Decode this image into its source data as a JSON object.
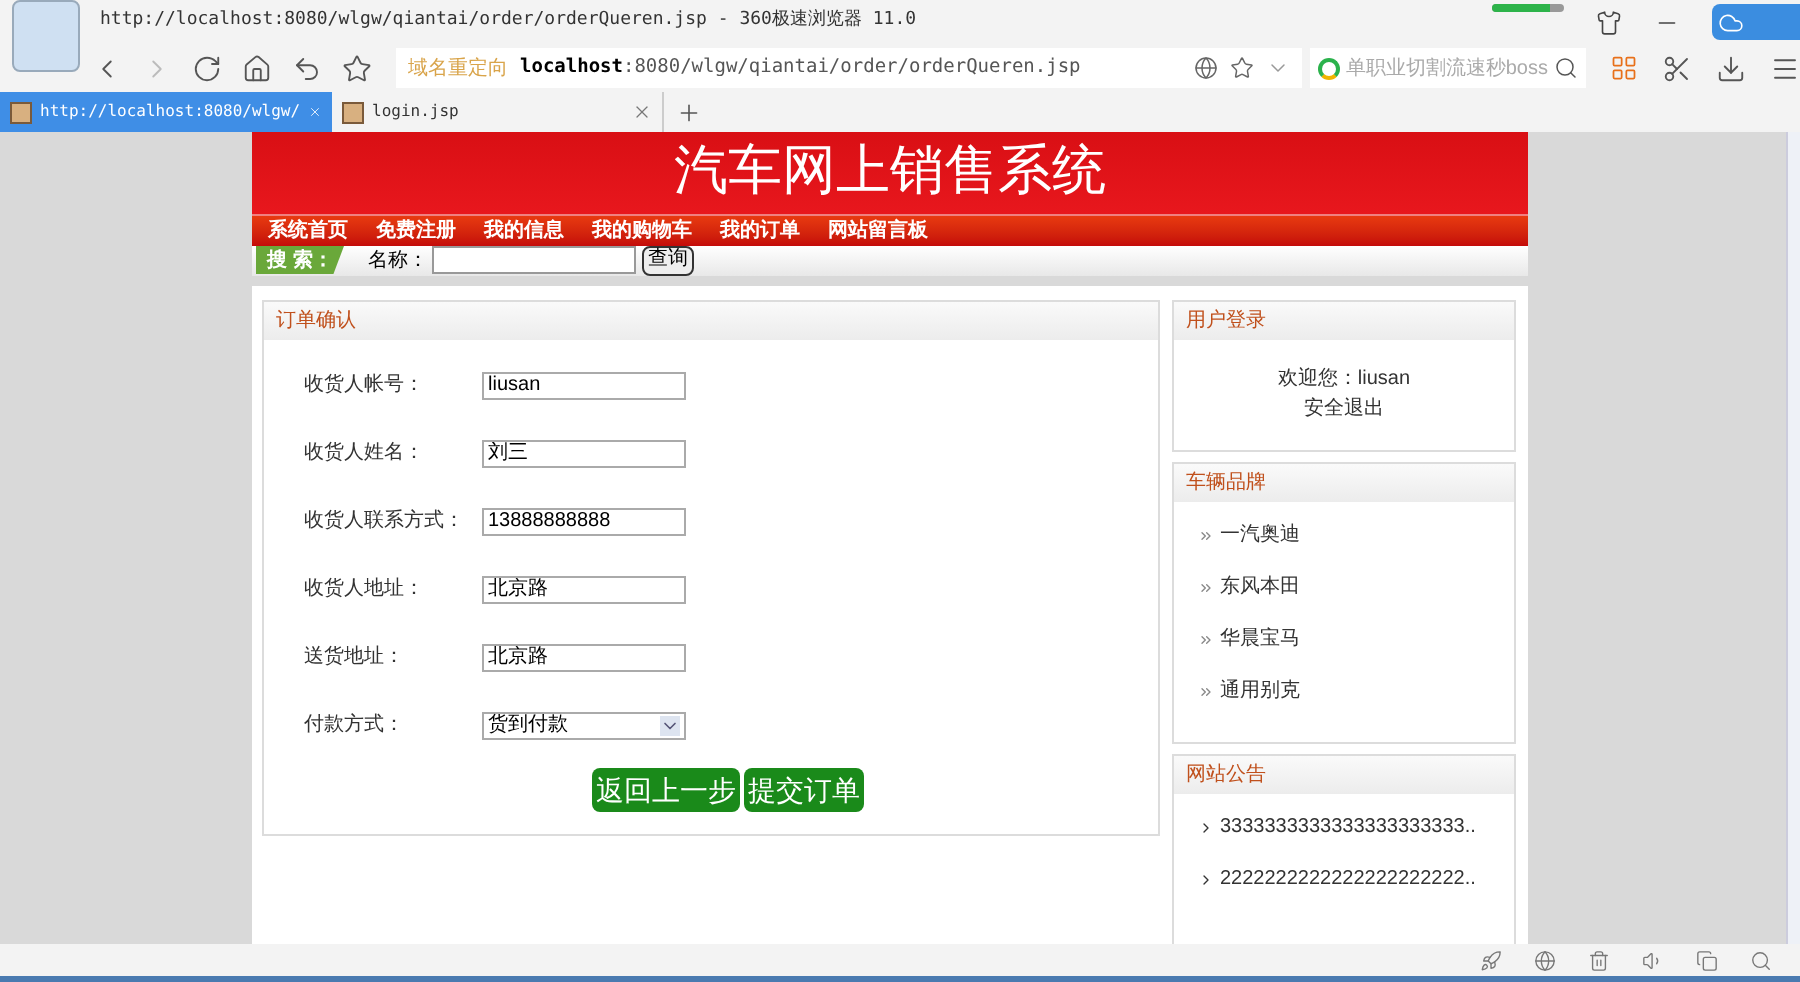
{
  "browser": {
    "title": "http://localhost:8080/wlgw/qiantai/order/orderQueren.jsp - 360极速浏览器 11.0",
    "address": {
      "label": "域名重定向",
      "host": "localhost",
      "path": ":8080/wlgw/qiantai/order/orderQueren.jsp"
    },
    "search_placeholder": "单职业切割流速秒boss",
    "progress": {
      "level": 0.8
    },
    "tabs": [
      {
        "title": "http://localhost:8080/wlgw/",
        "selected": true
      },
      {
        "title": "login.jsp",
        "selected": false
      }
    ]
  },
  "page": {
    "site_title": "汽车网上销售系统",
    "nav": [
      "系统首页",
      "免费注册",
      "我的信息",
      "我的购物车",
      "我的订单",
      "网站留言板"
    ],
    "search": {
      "tag": "搜 索：",
      "label": "名称：",
      "button": "查询"
    },
    "order": {
      "title": "订单确认",
      "fields": [
        {
          "kind": "text",
          "label": "收货人帐号：",
          "value": "liusan"
        },
        {
          "kind": "text",
          "label": "收货人姓名：",
          "value": "刘三"
        },
        {
          "kind": "text",
          "label": "收货人联系方式：",
          "value": "13888888888"
        },
        {
          "kind": "text",
          "label": "收货人地址：",
          "value": "北京路"
        },
        {
          "kind": "text",
          "label": "送货地址：",
          "value": "北京路"
        },
        {
          "kind": "select",
          "label": "付款方式：",
          "value": "货到付款"
        }
      ],
      "buttons": [
        "返回上一步",
        "提交订单"
      ]
    },
    "user_box": {
      "title": "用户登录",
      "welcome": "欢迎您：liusan",
      "logout": "安全退出"
    },
    "brands": {
      "title": "车辆品牌",
      "items": [
        "一汽奥迪",
        "东风本田",
        "华晨宝马",
        "通用别克"
      ]
    },
    "notices": {
      "title": "网站公告",
      "items": [
        "3333333333333333333333..",
        "2222222222222222222222.."
      ]
    }
  }
}
